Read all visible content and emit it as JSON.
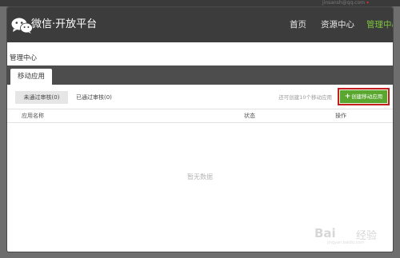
{
  "account": {
    "info": "jinsansh@qq.com",
    "logout_icon": "arrow-icon"
  },
  "header": {
    "brand": "微信·开放平台",
    "nav": [
      {
        "label": "首页",
        "active": false
      },
      {
        "label": "资源中心",
        "active": false
      },
      {
        "label": "管理中心",
        "active": true
      }
    ],
    "accent_color": "#7ec43b"
  },
  "main": {
    "section_title": "管理中心",
    "tabs": [
      {
        "label": "移动应用",
        "active": true
      }
    ],
    "filters": [
      {
        "label": "未通过审核(0)",
        "active": true
      },
      {
        "label": "已通过审核(0)",
        "active": false
      }
    ],
    "quota_text": "还可创建10个移动应用",
    "create_button": {
      "label": "创建移动应用",
      "icon": "plus-icon",
      "color": "#5aa72f"
    },
    "table": {
      "columns": [
        "应用名称",
        "状态",
        "操作"
      ],
      "rows": [],
      "empty_text": "暂无数据"
    }
  },
  "watermark": {
    "brand": "Bai",
    "sub": "经验",
    "url": "jingyan.baidu.com"
  }
}
